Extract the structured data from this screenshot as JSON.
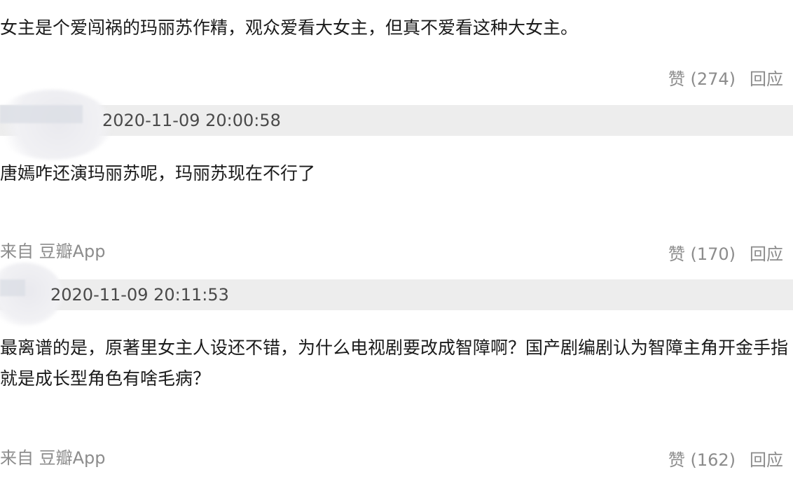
{
  "comments": [
    {
      "text": "女主是个爱闯祸的玛丽苏作精，观众爱看大女主，但真不爱看这种大女主。",
      "like_label": "赞",
      "like_count": "(274)",
      "reply_label": "回应"
    },
    {
      "timestamp": "2020-11-09 20:00:58",
      "text": "唐嫣咋还演玛丽苏呢，玛丽苏现在不行了",
      "source": "来自 豆瓣App",
      "like_label": "赞",
      "like_count": "(170)",
      "reply_label": "回应"
    },
    {
      "timestamp": "2020-11-09 20:11:53",
      "text": "最离谱的是，原著里女主人设还不错，为什么电视剧要改成智障啊？国产剧编剧认为智障主角开金手指就是成长型角色有啥毛病？",
      "source": "来自 豆瓣App",
      "like_label": "赞",
      "like_count": "(162)",
      "reply_label": "回应"
    }
  ]
}
